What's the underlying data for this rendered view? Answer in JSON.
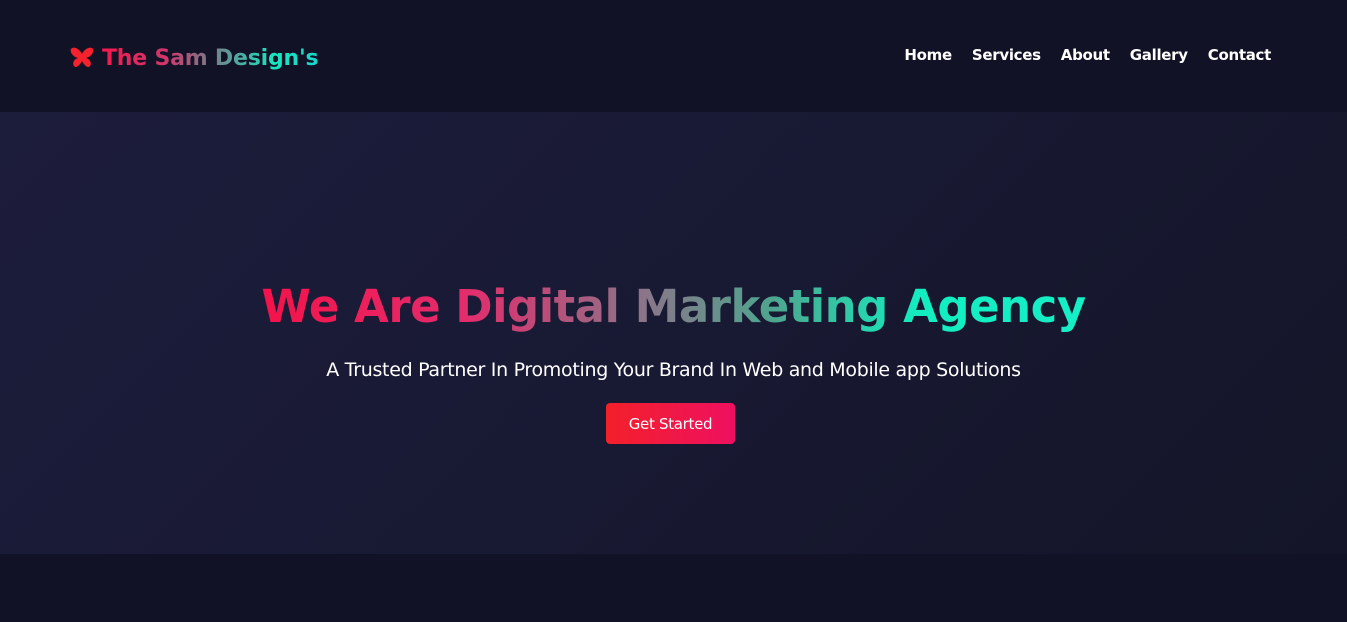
{
  "header": {
    "logo_icon": "butterfly-icon",
    "logo_text": "The Sam Design's",
    "nav": [
      {
        "label": "Home"
      },
      {
        "label": "Services"
      },
      {
        "label": "About"
      },
      {
        "label": "Gallery"
      },
      {
        "label": "Contact"
      }
    ]
  },
  "hero": {
    "title": "We Are Digital Marketing Agency",
    "subtitle": "A Trusted Partner In Promoting Your Brand In Web and Mobile app Solutions",
    "cta_label": "Get Started"
  },
  "colors": {
    "background": "#111225",
    "hero_background": "#1c1d3b",
    "accent_red": "#f4194d",
    "accent_teal": "#18e6c0",
    "cta": "#f3202a"
  }
}
